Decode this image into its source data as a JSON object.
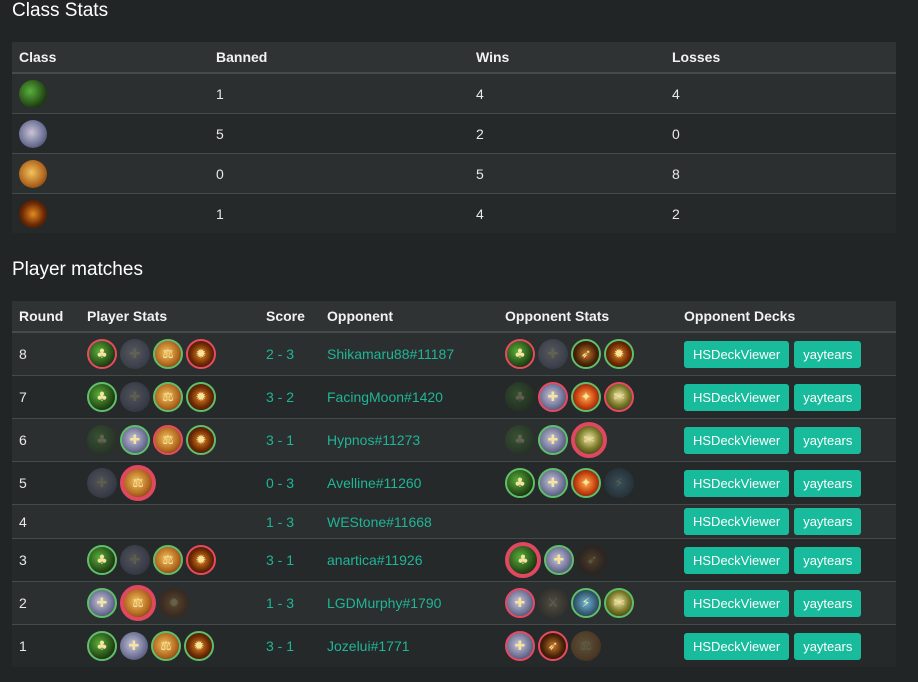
{
  "class_stats": {
    "title": "Class Stats",
    "headers": [
      "Class",
      "Banned",
      "Wins",
      "Losses"
    ],
    "rows": [
      {
        "icon": "druid-icon",
        "banned": "1",
        "wins": "4",
        "losses": "4"
      },
      {
        "icon": "priest-icon",
        "banned": "5",
        "wins": "2",
        "losses": "0"
      },
      {
        "icon": "paladin-icon",
        "banned": "0",
        "wins": "5",
        "losses": "8"
      },
      {
        "icon": "warlock-icon",
        "banned": "1",
        "wins": "4",
        "losses": "2"
      }
    ]
  },
  "player_matches": {
    "title": "Player matches",
    "headers": [
      "Round",
      "Player Stats",
      "Score",
      "Opponent",
      "Opponent Stats",
      "Opponent Decks"
    ],
    "deck_buttons": [
      "HSDeckViewer",
      "yaytears"
    ],
    "rows": [
      {
        "round": "8",
        "score": "2 - 3",
        "opponent": "Shikamaru88#11187",
        "player_stats": [
          "druid:loss",
          "priest:banned",
          "paladin:win",
          "warlock:loss"
        ],
        "opponent_stats": [
          "druid:loss",
          "priest:banned",
          "hunter:win",
          "warlock:win"
        ]
      },
      {
        "round": "7",
        "score": "3 - 2",
        "opponent": "FacingMoon#1420",
        "player_stats": [
          "druid:win",
          "priest:banned",
          "paladin:win",
          "warlock:win"
        ],
        "opponent_stats": [
          "druid:banned",
          "priest:loss",
          "mage:win",
          "rogue:loss"
        ]
      },
      {
        "round": "6",
        "score": "3 - 1",
        "opponent": "Hypnos#11273",
        "player_stats": [
          "druid:banned",
          "priest:win",
          "paladin:loss",
          "warlock:win"
        ],
        "opponent_stats": [
          "druid:banned",
          "priest:win",
          "rogue:big"
        ]
      },
      {
        "round": "5",
        "score": "0 - 3",
        "opponent": "Avelline#11260",
        "player_stats": [
          "priest:banned",
          "paladin:big"
        ],
        "opponent_stats": [
          "druid:win",
          "priest:win",
          "mage:win",
          "shaman:banned"
        ]
      },
      {
        "round": "4",
        "score": "1 - 3",
        "opponent": "WEStone#11668",
        "player_stats": [],
        "opponent_stats": []
      },
      {
        "round": "3",
        "score": "3 - 1",
        "opponent": "anartica#11926",
        "player_stats": [
          "druid:win",
          "priest:banned",
          "paladin:win",
          "warlock:loss"
        ],
        "opponent_stats": [
          "druid:big",
          "priest:win",
          "hunter:banned"
        ]
      },
      {
        "round": "2",
        "score": "1 - 3",
        "opponent": "LGDMurphy#1790",
        "player_stats": [
          "priest:win",
          "paladin:big",
          "warlock:banned"
        ],
        "opponent_stats": [
          "priest:loss",
          "warrior:banned",
          "shaman:win",
          "rogue:win"
        ]
      },
      {
        "round": "1",
        "score": "3 - 1",
        "opponent": "Jozelui#1771",
        "player_stats": [
          "druid:win",
          "priest:plain",
          "paladin:win",
          "warlock:win"
        ],
        "opponent_stats": [
          "priest:loss",
          "hunter:loss",
          "paladin:banned"
        ]
      }
    ]
  },
  "colors": {
    "background": "#222526",
    "accent": "#18bc9c",
    "link": "#20b597",
    "win_ring": "#5fbf6a",
    "loss_ring": "#e84a61"
  }
}
